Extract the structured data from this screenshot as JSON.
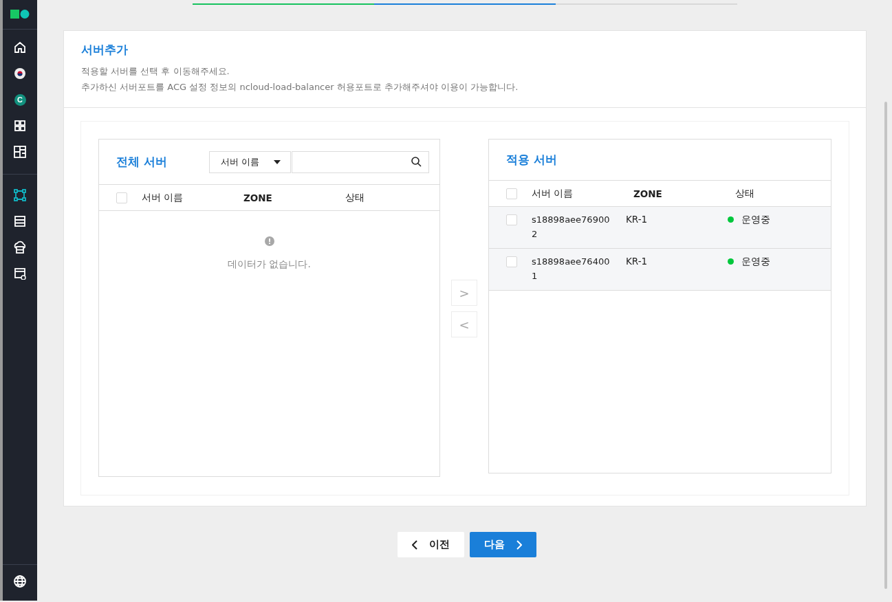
{
  "sidebar": {
    "items": [
      {
        "selected": false
      },
      {
        "selected": false
      },
      {
        "label": "C",
        "selected": false
      },
      {
        "selected": false
      },
      {
        "selected": false
      }
    ],
    "items_2": [
      {
        "selected": true
      },
      {
        "selected": false
      },
      {
        "selected": false
      },
      {
        "selected": false
      }
    ]
  },
  "steps": [
    {
      "done": true,
      "selected": false
    },
    {
      "done": false,
      "selected": true
    },
    {
      "done": false,
      "selected": false
    }
  ],
  "section": {
    "title": "서버추가",
    "lines": [
      "적용할 서버를 선택 후 이동해주세요.",
      "추가하신 서버포트를 ACG 설정 정보의 ncloud-load-balancer 허용포트로 추가해주셔야 이용이 가능합니다."
    ]
  },
  "left_list": {
    "title": "전체 서버",
    "filter": {
      "value": "서버 이름"
    },
    "columns": [
      "서버 이름",
      "ZONE",
      "상태"
    ],
    "header_checked": false,
    "empty_message": "데이터가 없습니다."
  },
  "move_buttons": [
    {
      "label": ">",
      "disabled": true
    },
    {
      "label": "<",
      "disabled": true
    }
  ],
  "right_list": {
    "title": "적용 서버",
    "columns": [
      "서버 이름",
      "ZONE",
      "상태"
    ],
    "header_checked": false,
    "rows": [
      {
        "checked": false,
        "name": "s18898aee769002",
        "zone": "KR-1",
        "status": "운영중",
        "color": "#00c73c"
      },
      {
        "checked": false,
        "name": "s18898aee764001",
        "zone": "KR-1",
        "status": "운영중",
        "color": "#00c73c"
      }
    ]
  },
  "buttons": [
    {
      "kind": "prev",
      "label": "이전"
    },
    {
      "kind": "next",
      "label": "다음"
    }
  ]
}
